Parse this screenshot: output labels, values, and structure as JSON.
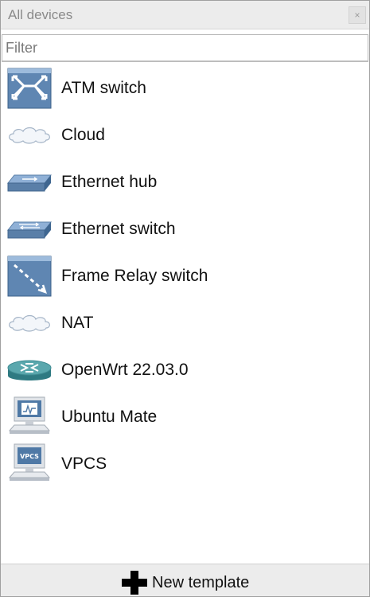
{
  "header": {
    "title": "All devices",
    "close_symbol": "×"
  },
  "filter": {
    "placeholder": "Filter",
    "value": ""
  },
  "devices": [
    {
      "label": "ATM switch",
      "icon": "atm-switch-icon"
    },
    {
      "label": "Cloud",
      "icon": "cloud-icon"
    },
    {
      "label": "Ethernet hub",
      "icon": "ethernet-hub-icon"
    },
    {
      "label": "Ethernet switch",
      "icon": "ethernet-switch-icon"
    },
    {
      "label": "Frame Relay switch",
      "icon": "frame-relay-switch-icon"
    },
    {
      "label": "NAT",
      "icon": "nat-cloud-icon"
    },
    {
      "label": "OpenWrt 22.03.0",
      "icon": "router-icon"
    },
    {
      "label": "Ubuntu Mate",
      "icon": "workstation-icon"
    },
    {
      "label": "VPCS",
      "icon": "vpcs-icon"
    }
  ],
  "footer": {
    "label": "New template",
    "icon": "plus-icon"
  },
  "colors": {
    "device_blue": "#5a7fa8",
    "device_light": "#8fb0d6",
    "router_teal": "#3f8b92"
  }
}
